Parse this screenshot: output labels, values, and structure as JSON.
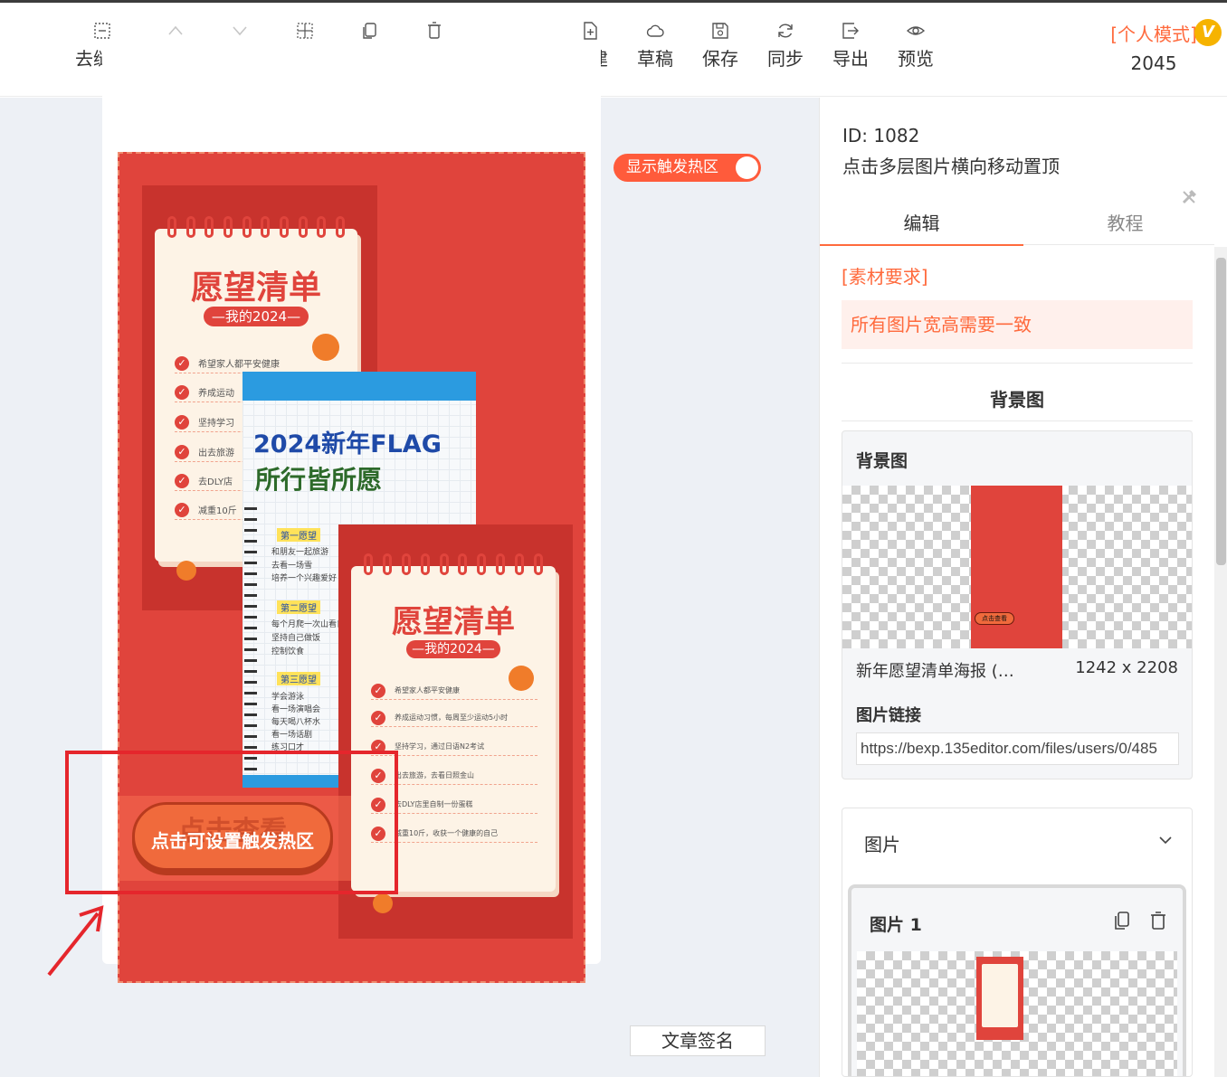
{
  "toolbar": {
    "left_tools": [
      {
        "label": "去缝隙",
        "icon": "gap-remove-icon",
        "disabled": false
      },
      {
        "label": "上移",
        "icon": "chevron-up-icon",
        "disabled": true
      },
      {
        "label": "下移",
        "icon": "chevron-down-icon",
        "disabled": true
      },
      {
        "label": "间距",
        "icon": "spacing-icon",
        "disabled": false
      },
      {
        "label": "复制",
        "icon": "copy-icon",
        "disabled": false
      },
      {
        "label": "删除",
        "icon": "trash-icon",
        "disabled": false
      }
    ],
    "right_tools": [
      {
        "label": "新建",
        "icon": "new-file-icon"
      },
      {
        "label": "草稿",
        "icon": "cloud-icon"
      },
      {
        "label": "保存",
        "icon": "save-icon"
      },
      {
        "label": "同步",
        "icon": "sync-icon"
      },
      {
        "label": "导出",
        "icon": "export-icon"
      },
      {
        "label": "预览",
        "icon": "eye-icon"
      }
    ],
    "mode_label": "[个人模式]",
    "mode_number": "2045",
    "vip_badge": "V"
  },
  "canvas": {
    "hot_toggle_label": "显示触发热区",
    "hot_toggle_on": true,
    "sign_button": "文章签名",
    "poster": {
      "note_title": "愿望清单",
      "note_subtitle": "—我的2024—",
      "note_items_back": [
        "希望家人都平安健康",
        "养成运动",
        "坚持学习",
        "出去旅游",
        "去DLY店",
        "减重10斤"
      ],
      "note_items_front": [
        "希望家人都平安健康",
        "养成运动习惯，每周至少运动5小时",
        "坚持学习，通过日语N2考试",
        "出去旅游，去看日照金山",
        "去DLY店里自制一份蛋糕",
        "减重10斤，收获一个健康的自己"
      ],
      "flag_title": "2024新年FLAG",
      "flag_subtitle": "所行皆所愿",
      "flag_sections": [
        {
          "name": "第一愿望",
          "lines": [
            "和朋友一起旅游",
            "去看一场雪",
            "培养一个兴趣爱好"
          ]
        },
        {
          "name": "第二愿望",
          "lines": [
            "每个月爬一次山看日",
            "坚持自己做饭",
            "控制饮食"
          ]
        },
        {
          "name": "第三愿望",
          "lines": [
            "学会游泳",
            "看一场演唱会",
            "每天喝八杯水",
            "看一场话剧",
            "练习口才"
          ]
        }
      ],
      "cta_ghost": "点击查看",
      "cta_text": "点击可设置触发热区",
      "accent": "#e0443c"
    }
  },
  "panel": {
    "id_label": "ID: 1082",
    "description": "点击多层图片横向移动置顶",
    "tabs": [
      {
        "label": "编辑",
        "active": true
      },
      {
        "label": "教程",
        "active": false
      }
    ],
    "requirement_label": "[素材要求]",
    "requirement_text": "所有图片宽高需要一致",
    "background_section_title": "背景图",
    "background_card": {
      "title": "背景图",
      "thumb_button": "点击查看",
      "file_name": "新年愿望清单海报 (…",
      "size": "1242 x 2208",
      "link_label": "图片链接",
      "link_value": "https://bexp.135editor.com/files/users/0/485"
    },
    "images_card": {
      "title": "图片",
      "item_title": "图片 1"
    }
  },
  "colors": {
    "accent_orange": "#ff6a3d",
    "poster_red": "#e0443c",
    "highlight_red": "#e5262c"
  }
}
